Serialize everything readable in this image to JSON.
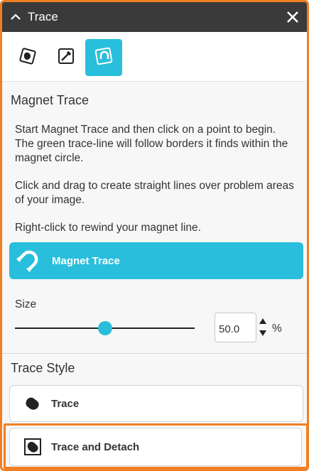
{
  "panel": {
    "title": "Trace",
    "accent_color": "#29bfdc",
    "highlight_color": "#f07f23"
  },
  "toolbar": {
    "tools": [
      {
        "icon": "trace-shape-icon",
        "active": false
      },
      {
        "icon": "eyedropper-icon",
        "active": false
      },
      {
        "icon": "magnet-trace-icon",
        "active": true
      }
    ]
  },
  "magnet": {
    "heading": "Magnet Trace",
    "desc1": "Start Magnet Trace and then click on a point to begin. The green trace-line will follow borders it finds within the magnet circle.",
    "desc2": "Click and drag to create straight lines over problem areas of your image.",
    "desc3": "Right-click to rewind your magnet line.",
    "button_label": "Magnet Trace"
  },
  "size": {
    "label": "Size",
    "value": "50.0",
    "unit": "%",
    "slider_fraction": 0.5
  },
  "trace_style": {
    "heading": "Trace Style",
    "options": [
      {
        "label": "Trace",
        "icon": "trace-blob-icon"
      },
      {
        "label": "Trace and Detach",
        "icon": "trace-detach-icon"
      }
    ]
  }
}
